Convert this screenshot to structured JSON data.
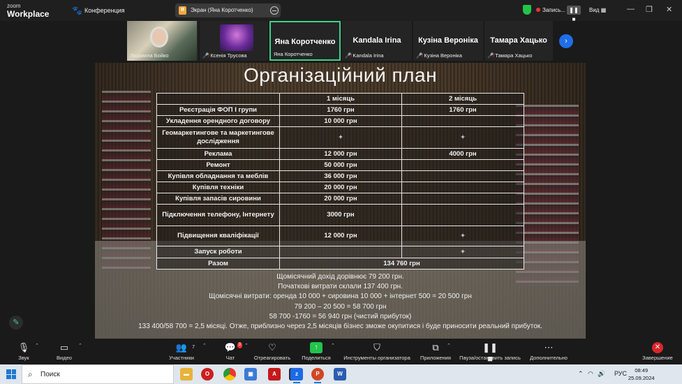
{
  "app": {
    "brand_small": "zoom",
    "brand": "Workplace",
    "meeting": "Конференция"
  },
  "screen_pill": {
    "badge": "Я",
    "label": "Экран (Яна Коротченко)"
  },
  "recording": {
    "label": "Запись..."
  },
  "view_label": "Вид",
  "participants": [
    {
      "name": "Людмила Бойко",
      "video": true
    },
    {
      "name": "Ксенія Трусова",
      "muted": true
    },
    {
      "name": "Яна Коротченко",
      "big": "Яна Коротченко",
      "active": true
    },
    {
      "name": "Kandala Irina",
      "big": "Kandala Irina",
      "muted": true
    },
    {
      "name": "Кузіна Вероніка",
      "big": "Кузіна Вероніка",
      "muted": true
    },
    {
      "name": "Тамара Хацько",
      "big": "Тамара Хацько",
      "muted": true
    }
  ],
  "slide": {
    "title": "Організаційний план",
    "header": [
      "",
      "1 місяць",
      "2 місяць"
    ],
    "rows": [
      [
        "Реєстрація ФОП I групи",
        "1760 грн",
        "1760 грн"
      ],
      [
        "Укладення орендного договору",
        "10 000 грн",
        ""
      ],
      [
        "Геомаркетингове та маркетингове дослідження",
        "+",
        "+"
      ],
      [
        "Реклама",
        "12 000 грн",
        "4000 грн"
      ],
      [
        "Ремонт",
        "50 000 грн",
        ""
      ],
      [
        "Купівля обладнання та меблів",
        "36 000 грн",
        ""
      ],
      [
        "Купівля техніки",
        "20 000 грн",
        ""
      ],
      [
        "Купівля запасів сировини",
        "20 000 грн",
        ""
      ],
      [
        "Підключення телефону, Інтернету",
        "3000 грн",
        ""
      ],
      [
        "Підвищення кваліфікації",
        "12 000 грн",
        "+"
      ],
      [
        "Запуск роботи",
        "",
        "+"
      ]
    ],
    "total_label": "Разом",
    "total_value": "134 760 грн",
    "notes": [
      "Щомісячний дохід дорівнює 79 200 грн.",
      "Початкові витрати склали 137 400 грн.",
      "Щомісячні витрати: оренда 10 000 + сировина 10 000 + інтернет 500 = 20 500 грн",
      "79 200 – 20 500 = 58 700 грн",
      "58 700 -1760 = 56 940 грн (чистий прибуток)",
      "133 400/58 700 = 2,5 місяці. Отже, приблизно через 2,5 місяців бізнес зможе окупитися і буде приносити реальний прибуток."
    ]
  },
  "toolbar": {
    "audio": "Звук",
    "video": "Видео",
    "participants": "Участники",
    "participants_count": "7",
    "chat": "Чат",
    "chat_badge": "3",
    "react": "Отреагировать",
    "share": "Поделиться",
    "host_tools": "Инструменты организатора",
    "apps": "Приложения",
    "pause_record": "Пауза/остановить запись",
    "more": "Дополнительно",
    "end": "Завершение"
  },
  "taskbar": {
    "search": "Поиск",
    "lang": "РУС",
    "time": "08:49",
    "date": "25.09.2024"
  }
}
